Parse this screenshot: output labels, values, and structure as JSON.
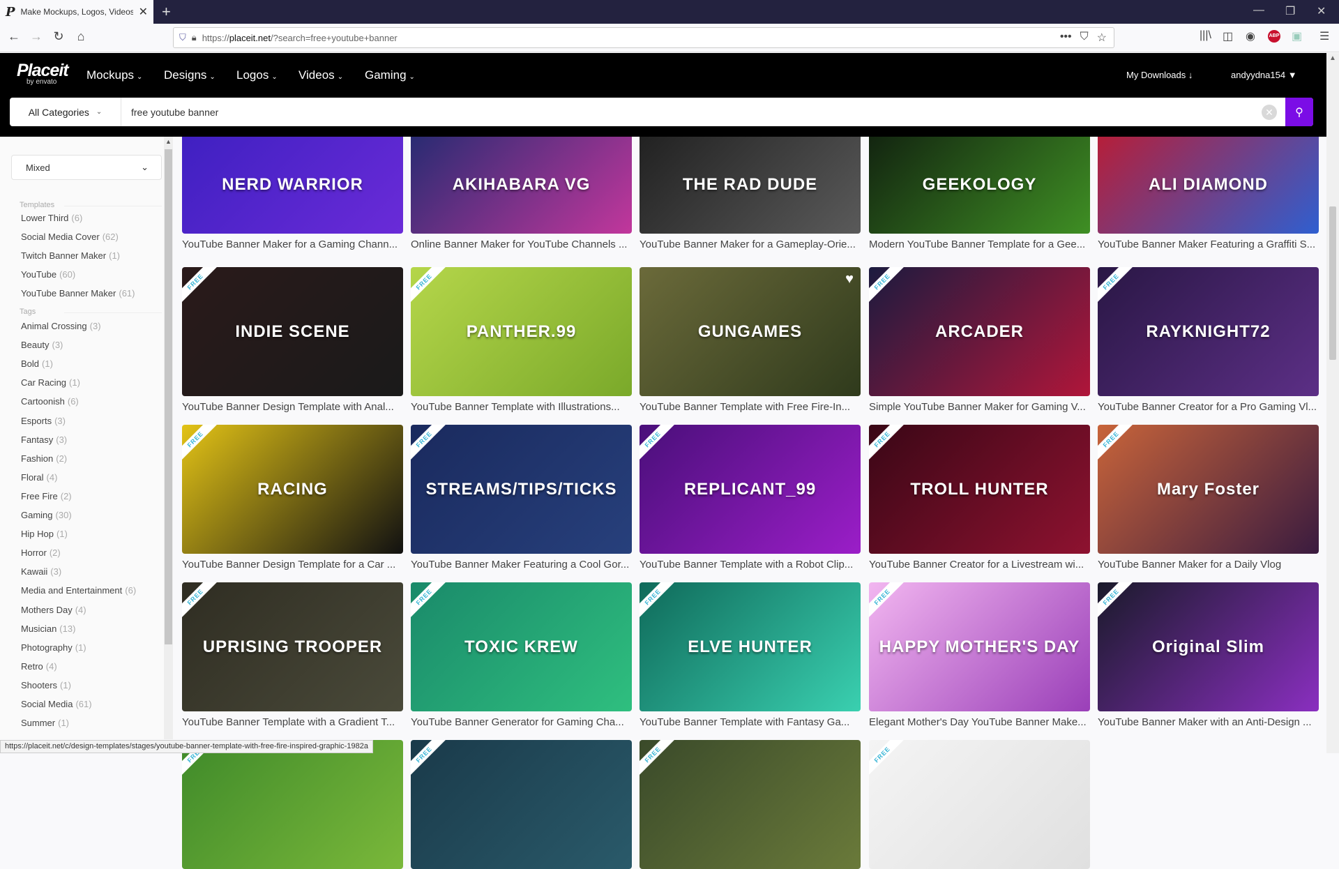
{
  "browser": {
    "tab_title": "Make Mockups, Logos, Videos",
    "tab_favicon": "P",
    "url_prefix": "https://",
    "url_domain": "placeit.net",
    "url_rest": "/?search=free+youtube+banner",
    "status_url": "https://placeit.net/c/design-templates/stages/youtube-banner-template-with-free-fire-inspired-graphic-1982a",
    "icons": [
      "back-icon",
      "forward-icon",
      "reload-icon",
      "home-icon",
      "shield-icon",
      "lock-icon",
      "more-icon",
      "pocket-icon",
      "star-icon",
      "library-icon",
      "sidebar-icon",
      "account-icon",
      "adblock-icon",
      "extension-icon",
      "menu-icon"
    ],
    "adblock_label": "ABP"
  },
  "site": {
    "logo": "Placeit",
    "logo_sub": "by envato",
    "nav": [
      {
        "label": "Mockups"
      },
      {
        "label": "Designs"
      },
      {
        "label": "Logos"
      },
      {
        "label": "Videos"
      },
      {
        "label": "Gaming"
      }
    ],
    "my_downloads": "My Downloads",
    "username": "andyydna154",
    "accent": "#7b0de6"
  },
  "search": {
    "category": "All Categories",
    "query": "free youtube banner"
  },
  "sidebar": {
    "sort": "Mixed",
    "templates_heading": "Templates",
    "templates": [
      {
        "label": "Lower Third",
        "count": "(6)"
      },
      {
        "label": "Social Media Cover",
        "count": "(62)"
      },
      {
        "label": "Twitch Banner Maker",
        "count": "(1)"
      },
      {
        "label": "YouTube",
        "count": "(60)"
      },
      {
        "label": "YouTube Banner Maker",
        "count": "(61)"
      }
    ],
    "tags_heading": "Tags",
    "tags": [
      {
        "label": "Animal Crossing",
        "count": "(3)"
      },
      {
        "label": "Beauty",
        "count": "(3)"
      },
      {
        "label": "Bold",
        "count": "(1)"
      },
      {
        "label": "Car Racing",
        "count": "(1)"
      },
      {
        "label": "Cartoonish",
        "count": "(6)"
      },
      {
        "label": "Esports",
        "count": "(3)"
      },
      {
        "label": "Fantasy",
        "count": "(3)"
      },
      {
        "label": "Fashion",
        "count": "(2)"
      },
      {
        "label": "Floral",
        "count": "(4)"
      },
      {
        "label": "Free Fire",
        "count": "(2)"
      },
      {
        "label": "Gaming",
        "count": "(30)"
      },
      {
        "label": "Hip Hop",
        "count": "(1)"
      },
      {
        "label": "Horror",
        "count": "(2)"
      },
      {
        "label": "Kawaii",
        "count": "(3)"
      },
      {
        "label": "Media and Entertainment",
        "count": "(6)"
      },
      {
        "label": "Mothers Day",
        "count": "(4)"
      },
      {
        "label": "Musician",
        "count": "(13)"
      },
      {
        "label": "Photography",
        "count": "(1)"
      },
      {
        "label": "Retro",
        "count": "(4)"
      },
      {
        "label": "Shooters",
        "count": "(1)"
      },
      {
        "label": "Social Media",
        "count": "(61)"
      },
      {
        "label": "Summer",
        "count": "(1)"
      }
    ]
  },
  "ribbon_label": "FREE",
  "results": [
    {
      "title": "YouTube Banner Maker for a Gaming Chann...",
      "thumb_text": "NERD WARRIOR",
      "colors": [
        "#3b1fbf",
        "#6a2bd8"
      ],
      "free": false
    },
    {
      "title": "Online Banner Maker for YouTube Channels ...",
      "thumb_text": "AKIHABARA VG",
      "colors": [
        "#1a2a6e",
        "#c2379c"
      ],
      "free": false
    },
    {
      "title": "YouTube Banner Maker for a Gameplay-Orie...",
      "thumb_text": "THE RAD DUDE",
      "colors": [
        "#1c1c1c",
        "#5a5a5a"
      ],
      "free": false
    },
    {
      "title": "Modern YouTube Banner Template for a Gee...",
      "thumb_text": "GEEKOLOGY",
      "colors": [
        "#0e1a0e",
        "#3f8f24"
      ],
      "free": false
    },
    {
      "title": "YouTube Banner Maker Featuring a Graffiti S...",
      "thumb_text": "ALI DIAMOND",
      "colors": [
        "#c3182a",
        "#2f5fd0"
      ],
      "free": false
    },
    {
      "title": "YouTube Banner Design Template with Anal...",
      "thumb_text": "INDIE SCENE",
      "colors": [
        "#2a1a1a",
        "#1a1a1a"
      ],
      "free": true
    },
    {
      "title": "YouTube Banner Template with Illustrations...",
      "thumb_text": "PANTHER.99",
      "colors": [
        "#b5d64a",
        "#7aa92a"
      ],
      "free": true
    },
    {
      "title": "YouTube Banner Template with Free Fire-In...",
      "thumb_text": "GUNGAMES",
      "colors": [
        "#6b6a3a",
        "#2f3a1c"
      ],
      "free": false,
      "hovered": true
    },
    {
      "title": "Simple YouTube Banner Maker for Gaming V...",
      "thumb_text": "ARCADER",
      "colors": [
        "#1c1b3f",
        "#b0163a"
      ],
      "free": true
    },
    {
      "title": "YouTube Banner Creator for a Pro Gaming Vl...",
      "thumb_text": "RAYKNIGHT72",
      "colors": [
        "#2a1745",
        "#5c2f86"
      ],
      "free": true
    },
    {
      "title": "YouTube Banner Design Template for a Car ...",
      "thumb_text": "RACING",
      "colors": [
        "#e3c316",
        "#111111"
      ],
      "free": true
    },
    {
      "title": "YouTube Banner Maker Featuring a Cool Gor...",
      "thumb_text": "STREAMS/TIPS/TICKS",
      "colors": [
        "#1a2a5e",
        "#27407c"
      ],
      "free": true
    },
    {
      "title": "YouTube Banner Template with a Robot Clip...",
      "thumb_text": "REPLICANT_99",
      "colors": [
        "#4a0f7a",
        "#9b1ec8"
      ],
      "free": true
    },
    {
      "title": "YouTube Banner Creator for a Livestream wi...",
      "thumb_text": "TROLL HUNTER",
      "colors": [
        "#3a0716",
        "#8e1230"
      ],
      "free": true
    },
    {
      "title": "YouTube Banner Maker for a Daily Vlog",
      "thumb_text": "Mary Foster",
      "colors": [
        "#c8643a",
        "#3a1b3f"
      ],
      "free": true
    },
    {
      "title": "YouTube Banner Template with a Gradient T...",
      "thumb_text": "UPRISING TROOPER",
      "colors": [
        "#2f2d22",
        "#4a4a3a"
      ],
      "free": true
    },
    {
      "title": "YouTube Banner Generator for Gaming Cha...",
      "thumb_text": "TOXIC KREW",
      "colors": [
        "#1a8a6a",
        "#2fbf7f"
      ],
      "free": true
    },
    {
      "title": "YouTube Banner Template with Fantasy Ga...",
      "thumb_text": "ELVE HUNTER",
      "colors": [
        "#0f6a5a",
        "#3ad0b0"
      ],
      "free": true
    },
    {
      "title": "Elegant Mother's Day YouTube Banner Make...",
      "thumb_text": "HAPPY MOTHER'S DAY",
      "colors": [
        "#f2b6f0",
        "#9a3fb8"
      ],
      "free": true
    },
    {
      "title": "YouTube Banner Maker with an Anti-Design ...",
      "thumb_text": "Original Slim",
      "colors": [
        "#1a1a2a",
        "#8a2fc0"
      ],
      "free": true
    },
    {
      "title": "",
      "thumb_text": "",
      "colors": [
        "#3f8a2a",
        "#7ab83a"
      ],
      "free": true
    },
    {
      "title": "",
      "thumb_text": "",
      "colors": [
        "#1a3a4a",
        "#2a5a6a"
      ],
      "free": true
    },
    {
      "title": "",
      "thumb_text": "",
      "colors": [
        "#3a4a2a",
        "#6a7a3a"
      ],
      "free": true
    },
    {
      "title": "",
      "thumb_text": "",
      "colors": [
        "#f4f4f4",
        "#e0e0e0"
      ],
      "free": true
    }
  ]
}
